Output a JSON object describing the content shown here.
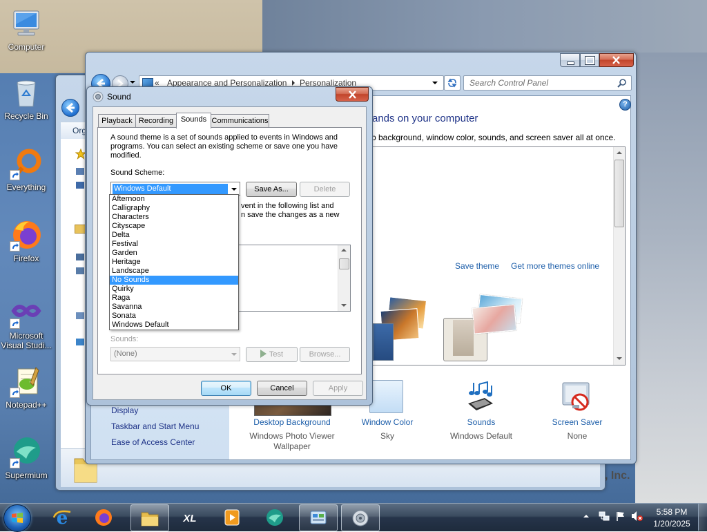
{
  "desktop": {
    "icons": [
      {
        "label": "Computer",
        "icon": "computer-icon"
      },
      {
        "label": "Recycle Bin",
        "icon": "recycle-bin-icon"
      },
      {
        "label": "Everything",
        "icon": "everything-icon"
      },
      {
        "label": "Firefox",
        "icon": "firefox-icon"
      },
      {
        "label": "Microsoft Visual Studi...",
        "icon": "visual-studio-icon"
      },
      {
        "label": "Notepad++",
        "icon": "notepad-plus-plus-icon"
      },
      {
        "label": "Supermium",
        "icon": "supermium-icon"
      }
    ],
    "wallpaper_text": ", Inc."
  },
  "explorer_window": {
    "toolbar_label": "Org"
  },
  "control_panel": {
    "address": {
      "prefix": "«",
      "crumbs": [
        "Appearance and Personalization",
        "Personalization"
      ]
    },
    "search_placeholder": "Search Control Panel",
    "heading": "ands on your computer",
    "subheading": "p background, window color, sounds, and screen saver all at once.",
    "theme_links": {
      "save_theme": "Save theme",
      "get_more": "Get more themes online"
    },
    "see_also": [
      "Display",
      "Taskbar and Start Menu",
      "Ease of Access Center"
    ],
    "bottom_items": [
      {
        "label": "Desktop Background",
        "value": "Windows Photo Viewer",
        "value2": "Wallpaper",
        "icon": "desktop-background-icon"
      },
      {
        "label": "Window Color",
        "value": "Sky",
        "icon": "window-color-icon"
      },
      {
        "label": "Sounds",
        "value": "Windows Default",
        "icon": "sounds-icon"
      },
      {
        "label": "Screen Saver",
        "value": "None",
        "icon": "screen-saver-icon"
      }
    ]
  },
  "sound_dialog": {
    "title": "Sound",
    "tabs": [
      "Playback",
      "Recording",
      "Sounds",
      "Communications"
    ],
    "active_tab": "Sounds",
    "description": "A sound theme is a set of sounds applied to events in Windows and programs.  You can select an existing scheme or save one you have modified.",
    "scheme_label": "Sound Scheme:",
    "scheme_value": "Windows Default",
    "save_as": "Save As...",
    "delete": "Delete",
    "partial_text": [
      "vent in the following list and",
      "n save the changes as a new"
    ],
    "sounds_label": "Sounds:",
    "sounds_value": "(None)",
    "test": "Test",
    "browse": "Browse...",
    "ok": "OK",
    "cancel": "Cancel",
    "apply": "Apply",
    "dropdown_options": [
      "Afternoon",
      "Calligraphy",
      "Characters",
      "Cityscape",
      "Delta",
      "Festival",
      "Garden",
      "Heritage",
      "Landscape",
      "No Sounds",
      "Quirky",
      "Raga",
      "Savanna",
      "Sonata",
      "Windows Default"
    ],
    "dropdown_highlighted": "No Sounds"
  },
  "taskbar": {
    "start_icon": "start-orb-icon",
    "buttons": [
      "internet-explorer-icon",
      "firefox-icon",
      "file-explorer-icon",
      "xl-app-icon",
      "media-player-icon",
      "supermium-icon",
      "control-panel-icon",
      "sound-icon"
    ],
    "xl_logo_text": "XL",
    "tray_icons": [
      "show-hidden-icons-icon",
      "network-icon",
      "action-center-flag-icon",
      "speaker-muted-icon"
    ],
    "clock": {
      "time": "5:58 PM",
      "date": "1/20/2025"
    }
  },
  "colors": {
    "selection": "#3399ff",
    "link": "#1e3287",
    "close_button": "#c94b3b"
  }
}
